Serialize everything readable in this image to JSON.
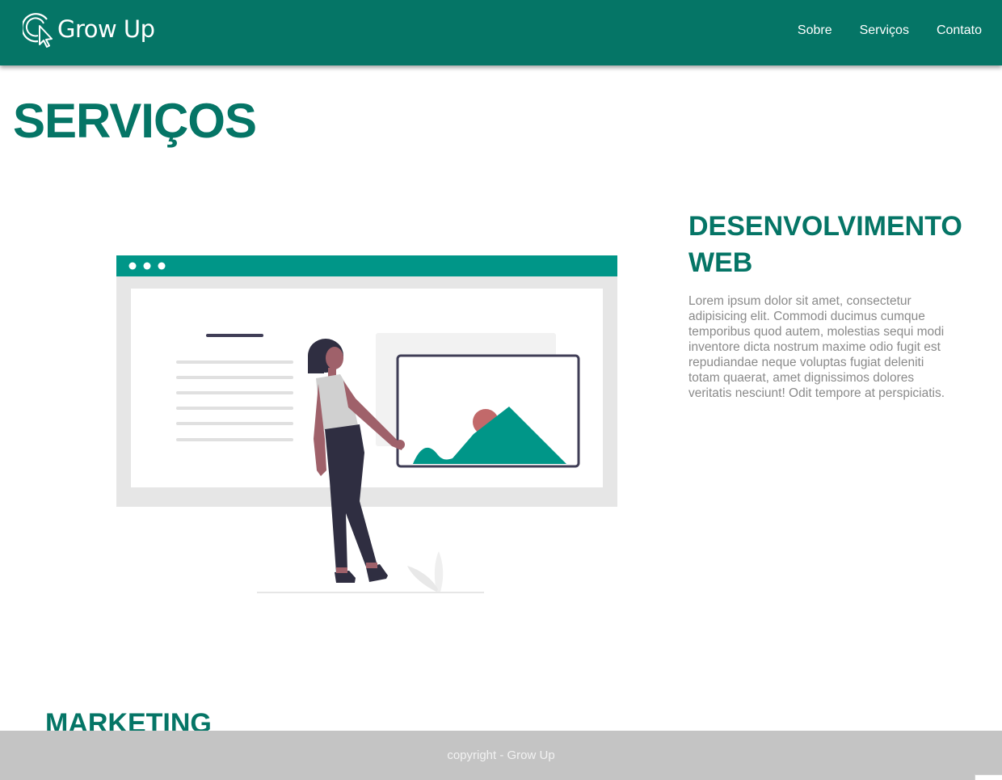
{
  "header": {
    "logo_text": "Grow Up",
    "nav": [
      "Sobre",
      "Serviços",
      "Contato"
    ]
  },
  "page": {
    "title": "SERVIÇOS"
  },
  "services": [
    {
      "title": "DESENVOLVIMENTO WEB",
      "description": "Lorem ipsum dolor sit amet, consectetur adipisicing elit. Commodi ducimus cumque temporibus quod autem, molestias sequi modi inventore dicta nostrum maxime odio fugit est repudiandae neque voluptas fugiat deleniti totam quaerat, amet dignissimos dolores veritatis nesciunt! Odit tempore at perspiciatis."
    },
    {
      "title": "MARKETING"
    }
  ],
  "footer": {
    "text": "copyright - Grow Up"
  },
  "colors": {
    "brand": "#057566",
    "illustration_accent": "#009688",
    "footer_bg": "#c4c4c4"
  },
  "icons": {
    "logo": "cursor-click-icon"
  }
}
